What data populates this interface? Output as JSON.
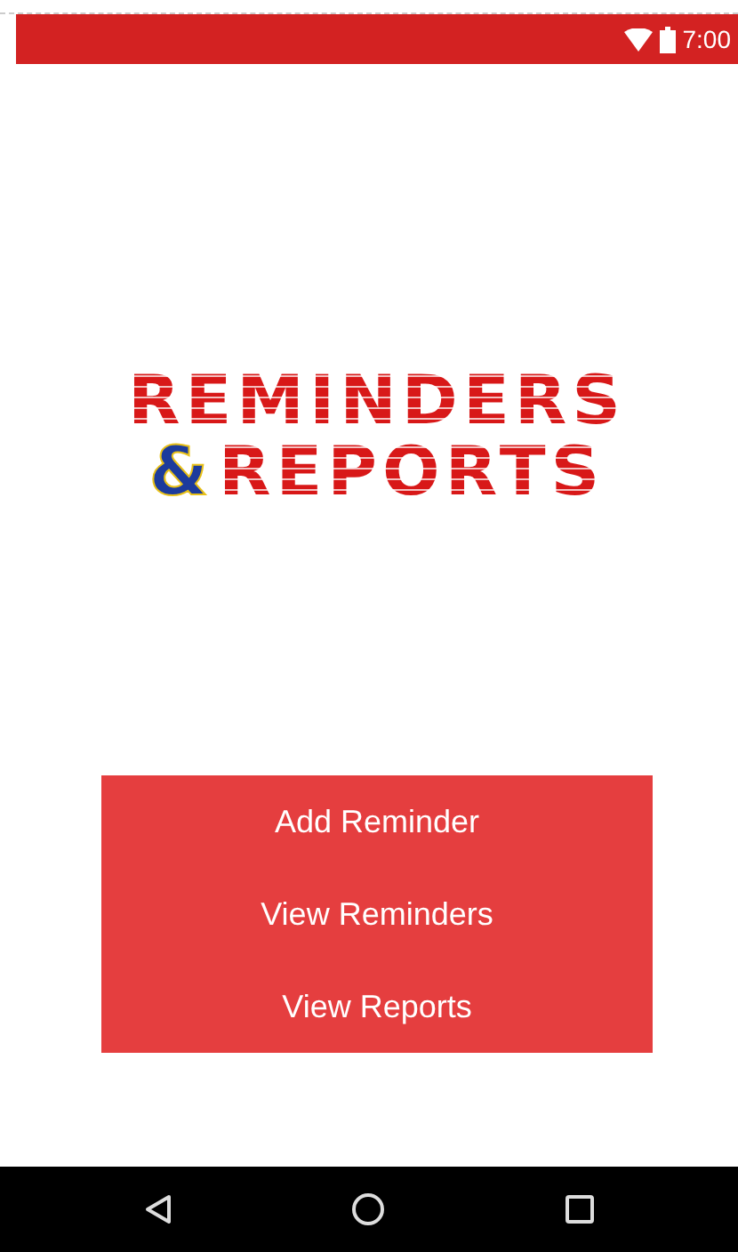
{
  "status_bar": {
    "time": "7:00"
  },
  "logo": {
    "line_1": "REMINDERS",
    "ampersand": "&",
    "line_2": "REPORTS"
  },
  "menu": [
    {
      "label": "Add Reminder"
    },
    {
      "label": "View Reminders"
    },
    {
      "label": "View Reports"
    }
  ]
}
